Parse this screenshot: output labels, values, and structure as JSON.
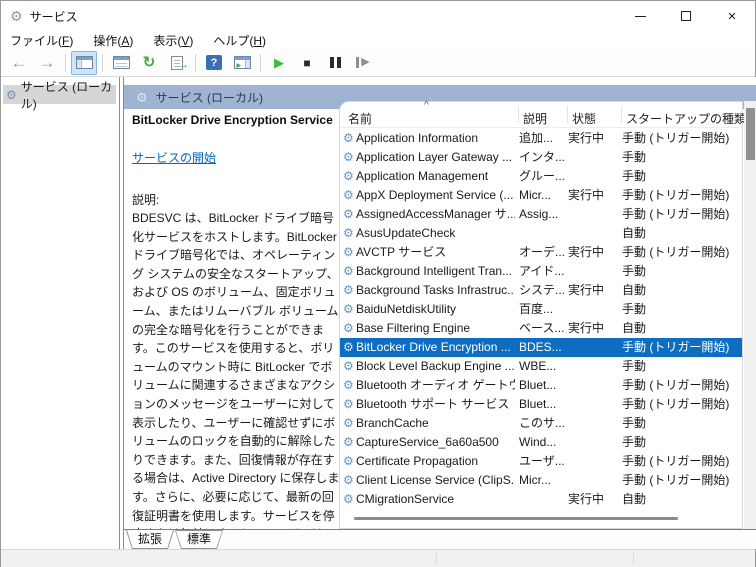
{
  "window": {
    "title": "サービス"
  },
  "menu": {
    "items": [
      {
        "pre": "ファイル(",
        "key": "F",
        "post": ")"
      },
      {
        "pre": "操作(",
        "key": "A",
        "post": ")"
      },
      {
        "pre": "表示(",
        "key": "V",
        "post": ")"
      },
      {
        "pre": "ヘルプ(",
        "key": "H",
        "post": ")"
      }
    ]
  },
  "toolbar": {
    "icons": [
      "back",
      "forward",
      "show-console-tree",
      "properties",
      "refresh",
      "export-list",
      "help",
      "show-action-pane",
      "start-service",
      "stop-service",
      "pause-service",
      "restart-service"
    ]
  },
  "icons": {
    "gear": "⚙",
    "sort_caret": "^",
    "back": "←",
    "forward": "→",
    "refresh": "↻",
    "export_arrow": "→",
    "help": "?",
    "play": "▶",
    "stop": "■",
    "close": "×"
  },
  "tree": {
    "items": [
      {
        "label": "サービス (ローカル)",
        "selected": true
      }
    ]
  },
  "extended_panel": {
    "header": "サービス (ローカル)",
    "service_title": "BitLocker Drive Encryption Service",
    "action_link": "サービスの開始",
    "description_label": "説明:",
    "description": "BDESVC は、BitLocker ドライブ暗号化サービスをホストします。BitLocker ドライブ暗号化では、オペレーティング システムの安全なスタートアップ、および OS のボリューム、固定ボリューム、またはリムーバブル ボリュームの完全な暗号化を行うことができます。このサービスを使用すると、ボリュームのマウント時に BitLocker でボリュームに関連するさまざまなアクションのメッセージをユーザーに対して表示したり、ユーザーに確認せずにボリュームのロックを自動的に解除したりできます。また、回復情報が存在する場合は、Active Directory に保存します。さらに、必要に応じて、最新の回復証明書を使用します。サービスを停止または無効にすると、ユーザーはこの機能を利用できなくなります。"
  },
  "table": {
    "columns": [
      "名前",
      "説明",
      "状態",
      "スタートアップの種類"
    ],
    "sort_indicator": "^",
    "rows": [
      {
        "name": "Application Information",
        "description": "追加...",
        "status": "実行中",
        "startup": "手動 (トリガー開始)",
        "selected": false
      },
      {
        "name": "Application Layer Gateway ...",
        "description": "インタ...",
        "status": "",
        "startup": "手動",
        "selected": false
      },
      {
        "name": "Application Management",
        "description": "グルー...",
        "status": "",
        "startup": "手動",
        "selected": false
      },
      {
        "name": "AppX Deployment Service (...",
        "description": "Micr...",
        "status": "実行中",
        "startup": "手動 (トリガー開始)",
        "selected": false
      },
      {
        "name": "AssignedAccessManager サ...",
        "description": "Assig...",
        "status": "",
        "startup": "手動 (トリガー開始)",
        "selected": false
      },
      {
        "name": "AsusUpdateCheck",
        "description": "",
        "status": "",
        "startup": "自動",
        "selected": false
      },
      {
        "name": "AVCTP サービス",
        "description": "オーデ...",
        "status": "実行中",
        "startup": "手動 (トリガー開始)",
        "selected": false
      },
      {
        "name": "Background Intelligent Tran...",
        "description": "アイド...",
        "status": "",
        "startup": "手動",
        "selected": false
      },
      {
        "name": "Background Tasks Infrastruc...",
        "description": "システ...",
        "status": "実行中",
        "startup": "自動",
        "selected": false
      },
      {
        "name": "BaiduNetdiskUtility",
        "description": "百度...",
        "status": "",
        "startup": "手動",
        "selected": false
      },
      {
        "name": "Base Filtering Engine",
        "description": "ベース...",
        "status": "実行中",
        "startup": "自動",
        "selected": false
      },
      {
        "name": "BitLocker Drive Encryption ...",
        "description": "BDES...",
        "status": "",
        "startup": "手動 (トリガー開始)",
        "selected": true
      },
      {
        "name": "Block Level Backup Engine ...",
        "description": "WBE...",
        "status": "",
        "startup": "手動",
        "selected": false
      },
      {
        "name": "Bluetooth オーディオ ゲートウェ...",
        "description": "Bluet...",
        "status": "",
        "startup": "手動 (トリガー開始)",
        "selected": false
      },
      {
        "name": "Bluetooth サポート サービス",
        "description": "Bluet...",
        "status": "",
        "startup": "手動 (トリガー開始)",
        "selected": false
      },
      {
        "name": "BranchCache",
        "description": "このサ...",
        "status": "",
        "startup": "手動",
        "selected": false
      },
      {
        "name": "CaptureService_6a60a500",
        "description": "Wind...",
        "status": "",
        "startup": "手動",
        "selected": false
      },
      {
        "name": "Certificate Propagation",
        "description": "ユーザ...",
        "status": "",
        "startup": "手動 (トリガー開始)",
        "selected": false
      },
      {
        "name": "Client License Service (ClipS...",
        "description": "Micr...",
        "status": "",
        "startup": "手動 (トリガー開始)",
        "selected": false
      },
      {
        "name": "CMigrationService",
        "description": "",
        "status": "実行中",
        "startup": "自動",
        "selected": false
      }
    ]
  },
  "tabs": {
    "items": [
      {
        "label": "拡張",
        "active": true
      },
      {
        "label": "標準",
        "active": false
      }
    ]
  },
  "colors": {
    "header_bar": "#9eb4d1",
    "selection": "#0d6ec1",
    "link": "#0563c1",
    "gear_icon": "#6a94ba"
  }
}
